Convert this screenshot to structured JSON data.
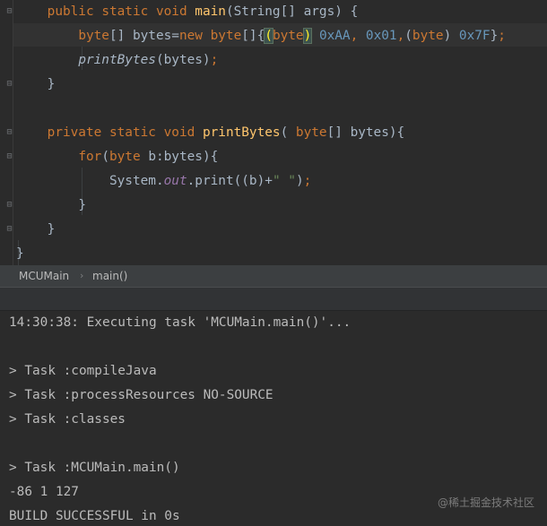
{
  "editor": {
    "lines": [
      {
        "indent": "    ",
        "tokens": [
          {
            "t": "public ",
            "c": "kw"
          },
          {
            "t": "static ",
            "c": "kw"
          },
          {
            "t": "void ",
            "c": "kw"
          },
          {
            "t": "main",
            "c": "fn"
          },
          {
            "t": "(String[] args) {",
            "c": ""
          }
        ]
      },
      {
        "indent": "        ",
        "tokens": [
          {
            "t": "byte",
            "c": "kw"
          },
          {
            "t": "[] bytes=",
            "c": ""
          },
          {
            "t": "new ",
            "c": "kw"
          },
          {
            "t": "byte",
            "c": "kw"
          },
          {
            "t": "[]{",
            "c": ""
          },
          {
            "t": "(",
            "c": "paren-match"
          },
          {
            "t": "byte",
            "c": "kw"
          },
          {
            "t": ")",
            "c": "paren-match"
          },
          {
            "t": " ",
            "c": ""
          },
          {
            "t": "0xAA",
            "c": "num"
          },
          {
            "t": ", ",
            "c": "kw"
          },
          {
            "t": "0x01",
            "c": "num"
          },
          {
            "t": ",",
            "c": "kw"
          },
          {
            "t": "(",
            "c": ""
          },
          {
            "t": "byte",
            "c": "kw"
          },
          {
            "t": ") ",
            "c": ""
          },
          {
            "t": "0x7F",
            "c": "num"
          },
          {
            "t": "}",
            "c": ""
          },
          {
            "t": ";",
            "c": "kw"
          }
        ]
      },
      {
        "indent": "        ",
        "tokens": [
          {
            "t": "printBytes",
            "c": "it"
          },
          {
            "t": "(bytes)",
            "c": ""
          },
          {
            "t": ";",
            "c": "kw"
          }
        ]
      },
      {
        "indent": "    ",
        "tokens": [
          {
            "t": "}",
            "c": ""
          }
        ]
      },
      {
        "indent": "",
        "tokens": []
      },
      {
        "indent": "    ",
        "tokens": [
          {
            "t": "private ",
            "c": "kw"
          },
          {
            "t": "static ",
            "c": "kw"
          },
          {
            "t": "void ",
            "c": "kw"
          },
          {
            "t": "printBytes",
            "c": "fn"
          },
          {
            "t": "( ",
            "c": ""
          },
          {
            "t": "byte",
            "c": "kw"
          },
          {
            "t": "[] bytes){",
            "c": ""
          }
        ]
      },
      {
        "indent": "        ",
        "tokens": [
          {
            "t": "for",
            "c": "kw"
          },
          {
            "t": "(",
            "c": ""
          },
          {
            "t": "byte ",
            "c": "kw"
          },
          {
            "t": "b:bytes){",
            "c": ""
          }
        ]
      },
      {
        "indent": "            ",
        "tokens": [
          {
            "t": "System.",
            "c": ""
          },
          {
            "t": "out",
            "c": "field"
          },
          {
            "t": ".print((b)+",
            "c": ""
          },
          {
            "t": "\" \"",
            "c": "str"
          },
          {
            "t": ")",
            "c": ""
          },
          {
            "t": ";",
            "c": "kw"
          }
        ]
      },
      {
        "indent": "        ",
        "tokens": [
          {
            "t": "}",
            "c": ""
          }
        ]
      },
      {
        "indent": "    ",
        "tokens": [
          {
            "t": "}",
            "c": ""
          }
        ]
      },
      {
        "indent": "",
        "tokens": [
          {
            "t": "}",
            "c": ""
          }
        ]
      }
    ]
  },
  "breadcrumb": {
    "class_name": "MCUMain",
    "separator": "›",
    "method_name": "main()"
  },
  "console": {
    "lines": [
      "14:30:38: Executing task 'MCUMain.main()'...",
      "",
      "> Task :compileJava",
      "> Task :processResources NO-SOURCE",
      "> Task :classes",
      "",
      "> Task :MCUMain.main()",
      "-86 1 127",
      "BUILD SUCCESSFUL in 0s"
    ]
  },
  "watermark": "@稀土掘金技术社区",
  "colors": {
    "background": "#2b2b2b",
    "keyword": "#cc7832",
    "function": "#ffc66d",
    "number": "#6897bb",
    "string": "#6a8759",
    "field": "#9876aa",
    "text": "#a9b7c6"
  }
}
